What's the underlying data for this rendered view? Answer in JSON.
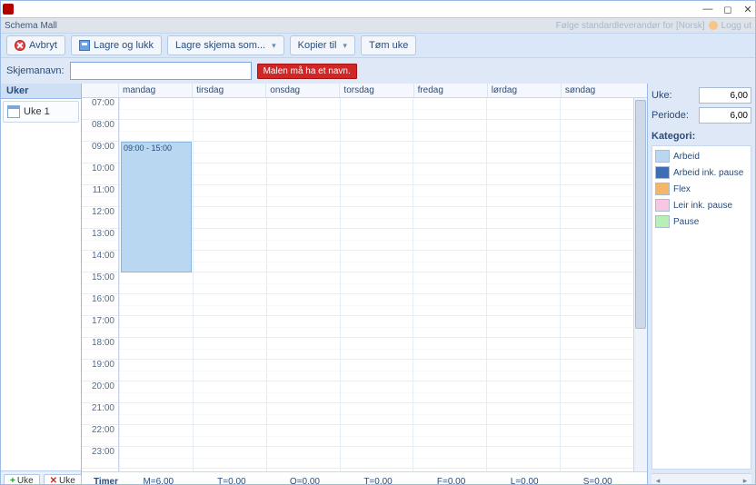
{
  "window": {
    "title": "Schema Mall",
    "status_right": "Følge standardleverandør for [Norsk]",
    "logout": "Logg ut"
  },
  "toolbar": {
    "cancel": "Avbryt",
    "save_close": "Lagre og lukk",
    "save_as": "Lagre skjema som...",
    "copy_to": "Kopier til",
    "clear_week": "Tøm uke"
  },
  "name_row": {
    "label": "Skjemanavn:",
    "value": "",
    "error": "Malen må ha et navn."
  },
  "uker": {
    "header": "Uker",
    "items": [
      "Uke 1"
    ],
    "add": "Uke",
    "del": "Uke"
  },
  "calendar": {
    "days": [
      "mandag",
      "tirsdag",
      "onsdag",
      "torsdag",
      "fredag",
      "lørdag",
      "søndag"
    ],
    "hours": [
      "07:00",
      "08:00",
      "09:00",
      "10:00",
      "11:00",
      "12:00",
      "13:00",
      "14:00",
      "15:00",
      "16:00",
      "17:00",
      "18:00",
      "19:00",
      "20:00",
      "21:00",
      "22:00",
      "23:00"
    ],
    "event": {
      "label": "09:00 - 15:00",
      "day": 0,
      "start": 2,
      "end": 8
    }
  },
  "footer": {
    "label": "Timer",
    "prefixes": [
      "M=",
      "T=",
      "O=",
      "T=",
      "F=",
      "L=",
      "S="
    ],
    "values": [
      "6,00",
      "0,00",
      "0,00",
      "0,00",
      "0,00",
      "0,00",
      "0,00"
    ]
  },
  "right": {
    "uke_label": "Uke:",
    "uke_value": "6,00",
    "periode_label": "Periode:",
    "periode_value": "6,00",
    "kat_header": "Kategori:",
    "kategorier": [
      {
        "name": "Arbeid",
        "color": "#b9d7f1"
      },
      {
        "name": "Arbeid ink. pause",
        "color": "#3f6db3"
      },
      {
        "name": "Flex",
        "color": "#f4b76a"
      },
      {
        "name": "Leir ink. pause",
        "color": "#f6c6e3"
      },
      {
        "name": "Pause",
        "color": "#b7efb7"
      }
    ]
  }
}
